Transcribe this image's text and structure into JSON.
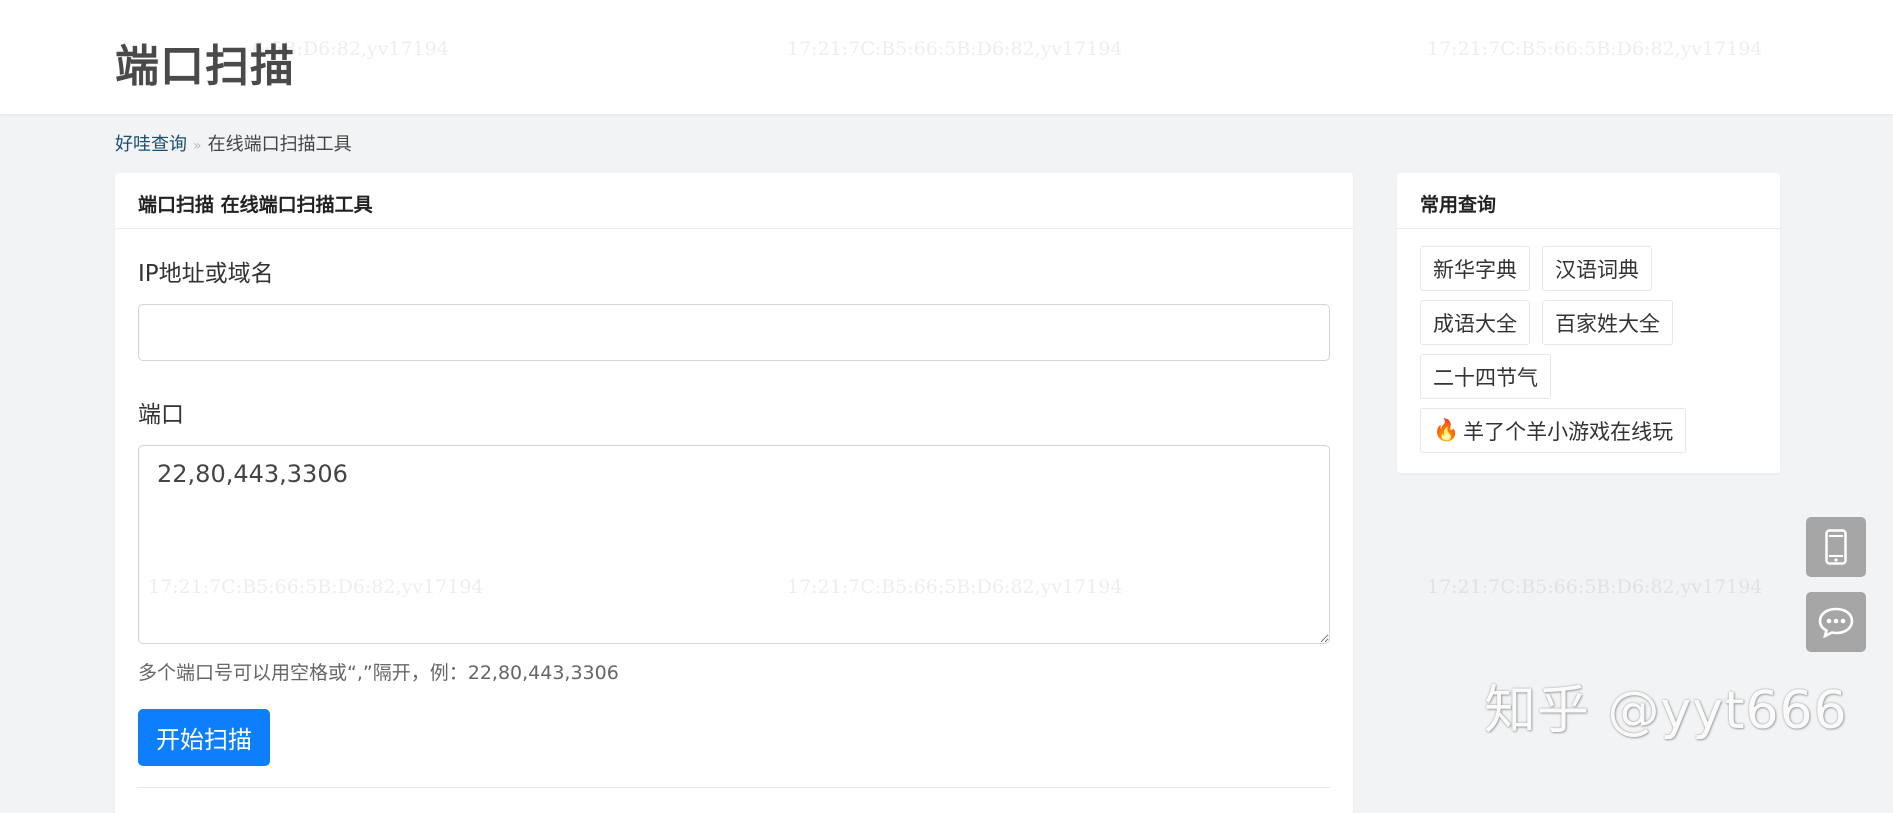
{
  "header": {
    "site_title": "端口扫描",
    "watermark_text": "17:21:7C:B5:66:5B:D6:82,yv17194",
    "watermark_partial": "6:5B:D6:82,yv17194"
  },
  "breadcrumb": {
    "home": "好哇查询",
    "separator": "»",
    "current": "在线端口扫描工具"
  },
  "main_card": {
    "title": "端口扫描 在线端口扫描工具",
    "ip_label": "IP地址或域名",
    "ip_value": "",
    "port_label": "端口",
    "port_value": "22,80,443,3306",
    "hint": "多个端口号可以用空格或“,”隔开，例：22,80,443,3306",
    "scan_button": "开始扫描"
  },
  "side_card": {
    "title": "常用查询",
    "tags": [
      "新华字典",
      "汉语词典",
      "成语大全",
      "百家姓大全",
      "二十四节气",
      "羊了个羊小游戏在线玩"
    ],
    "hot_icon": "fire-icon"
  },
  "floating": {
    "mobile_icon": "mobile-phone-icon",
    "feedback_icon": "chat-bubble-icon"
  },
  "overlay": {
    "zhihu_watermark": "知乎 @yyt666"
  },
  "colors": {
    "accent": "#0d7efc",
    "page_bg": "#f2f3f5",
    "float_button": "#a6a6a6"
  }
}
